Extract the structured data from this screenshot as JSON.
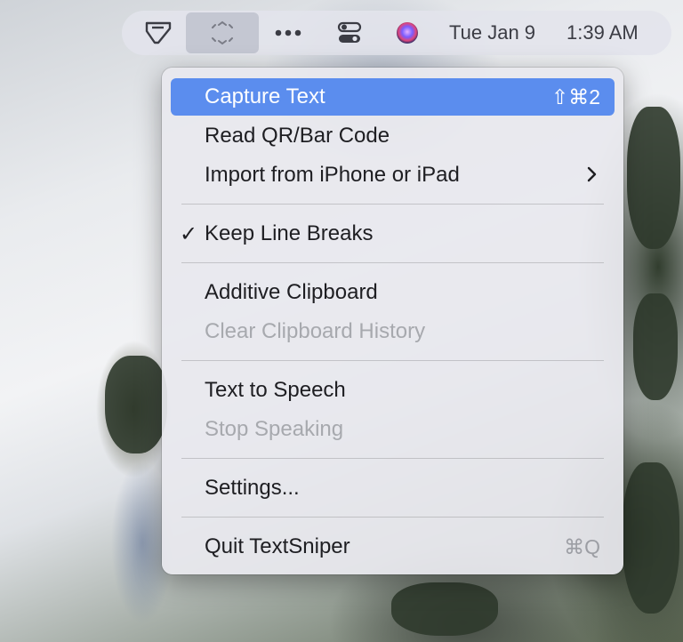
{
  "menubar": {
    "date": "Tue Jan 9",
    "time": "1:39 AM",
    "items": [
      {
        "icon": "textsniper-icon"
      },
      {
        "icon": "capture-frame-icon"
      },
      {
        "icon": "more-dots-icon"
      },
      {
        "icon": "control-center-icon"
      },
      {
        "icon": "siri-icon"
      }
    ]
  },
  "menu": {
    "capture_text": {
      "label": "Capture Text",
      "shortcut": "⇧⌘2"
    },
    "read_qr": {
      "label": "Read QR/Bar Code"
    },
    "import_iphone": {
      "label": "Import from iPhone or iPad"
    },
    "keep_line_breaks": {
      "label": "Keep Line Breaks",
      "checked": true,
      "check": "✓"
    },
    "additive_clipboard": {
      "label": "Additive Clipboard"
    },
    "clear_clipboard": {
      "label": "Clear Clipboard History",
      "enabled": false
    },
    "text_to_speech": {
      "label": "Text to Speech"
    },
    "stop_speaking": {
      "label": "Stop Speaking",
      "enabled": false
    },
    "settings": {
      "label": "Settings..."
    },
    "quit": {
      "label": "Quit TextSniper",
      "shortcut": "⌘Q"
    }
  },
  "colors": {
    "highlight": "#5b8dee",
    "menu_bg": "#e8e8ee",
    "disabled_text": "#a7a9ae"
  }
}
